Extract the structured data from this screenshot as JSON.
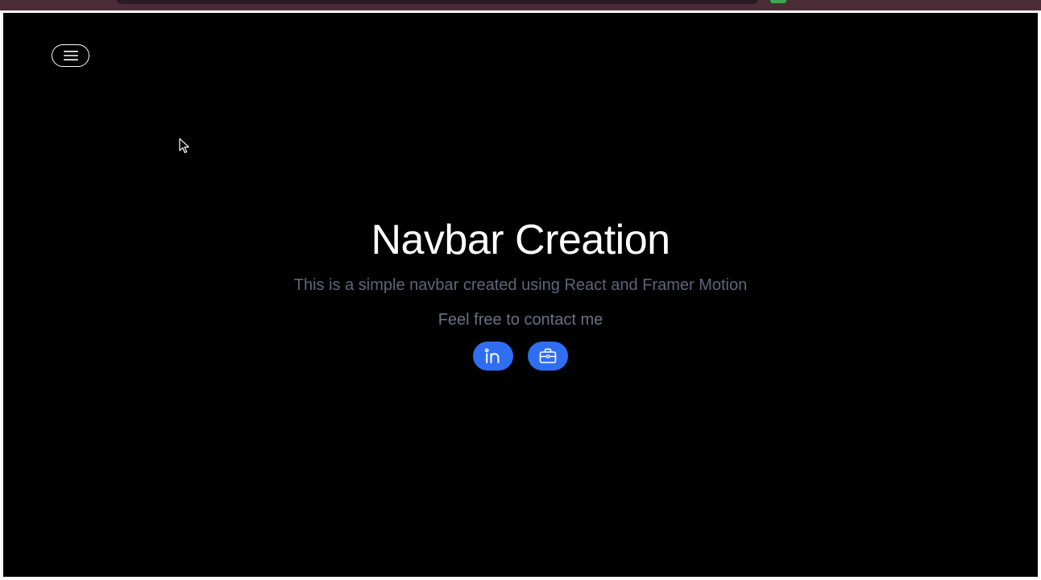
{
  "hero": {
    "title": "Navbar Creation",
    "subtitle": "This is a simple navbar created using React and Framer Motion",
    "contact_text": "Feel free to contact me"
  },
  "header": {
    "menu_icon": "hamburger-menu-icon"
  },
  "social": {
    "items": [
      {
        "icon": "linkedin-icon"
      },
      {
        "icon": "briefcase-icon"
      }
    ]
  },
  "colors": {
    "page_background": "#000000",
    "title": "#ffffff",
    "subtitle": "#5f6578",
    "accent": "#2f6ef2",
    "browser_chrome": "#4a2c37"
  }
}
